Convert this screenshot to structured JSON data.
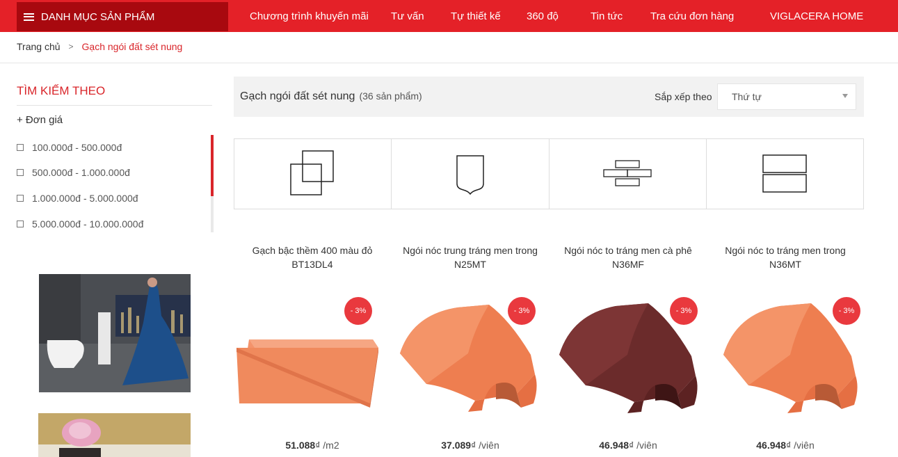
{
  "header": {
    "menu_label": "DANH MỤC SẢN PHẨM",
    "nav": [
      "Chương trình khuyến mãi",
      "Tư vấn",
      "Tự thiết kế",
      "360 độ",
      "Tin tức",
      "Tra cứu đơn hàng",
      "VIGLACERA HOME"
    ]
  },
  "breadcrumb": {
    "home": "Trang chủ",
    "separator": ">",
    "current": "Gạch ngói đất sét nung"
  },
  "sidebar": {
    "title": "TÌM KIẾM THEO",
    "group_title": "+ Đơn giá",
    "price_ranges": [
      "100.000đ - 500.000đ",
      "500.000đ - 1.000.000đ",
      "1.000.000đ - 5.000.000đ",
      "5.000.000đ - 10.000.000đ"
    ]
  },
  "main": {
    "category": "Gạch ngói đất sét nung",
    "count": "(36 sản phẩm)",
    "sort_label": "Sắp xếp theo",
    "sort_value": "Thứ tự"
  },
  "shape_icons": [
    "overlap-squares-icon",
    "ridge-tile-icon",
    "brick-pattern-icon",
    "two-rectangles-icon"
  ],
  "products": [
    {
      "name": "Gạch bậc thềm 400 màu đỏ BT13DL4",
      "badge": "- 3%",
      "price": "51.088",
      "currency": "₫",
      "unit": "/m2",
      "color": "#f08a5d"
    },
    {
      "name": "Ngói nóc trung tráng men trong N25MT",
      "badge": "- 3%",
      "price": "37.089",
      "currency": "₫",
      "unit": "/viên",
      "color": "#ee7e50"
    },
    {
      "name": "Ngói nóc to tráng men cà phê N36MF",
      "badge": "- 3%",
      "price": "46.948",
      "currency": "₫",
      "unit": "/viên",
      "color": "#6b2b2b"
    },
    {
      "name": "Ngói nóc to tráng men trong N36MT",
      "badge": "- 3%",
      "price": "46.948",
      "currency": "₫",
      "unit": "/viên",
      "color": "#ee7e50"
    }
  ],
  "colors": {
    "brand_red": "#e42128",
    "menu_dark_red": "#a8090f",
    "badge_red": "#e9393e"
  }
}
